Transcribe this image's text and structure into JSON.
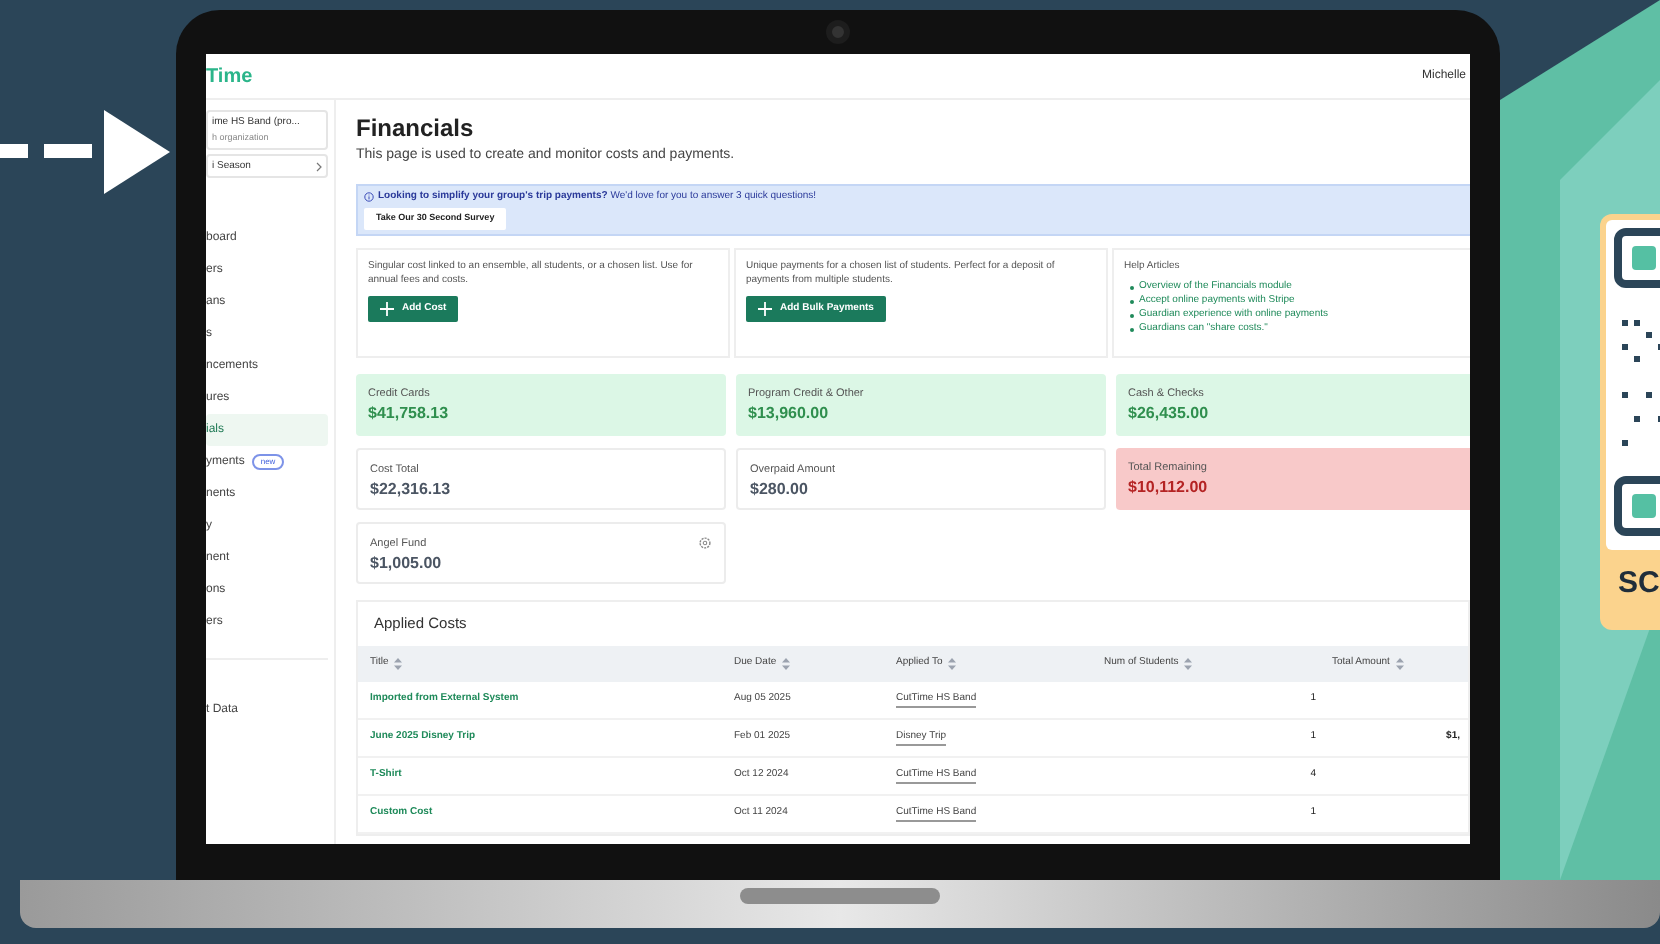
{
  "app": {
    "logo": "Time",
    "user": "Michelle"
  },
  "sidebar": {
    "org_name": "ime HS Band (pro...",
    "org_type": "h organization",
    "season": "i Season",
    "items": [
      {
        "label": "board",
        "selected": false
      },
      {
        "label": "ers",
        "selected": false
      },
      {
        "label": "ans",
        "selected": false
      },
      {
        "label": "s",
        "selected": false
      },
      {
        "label": "ncements",
        "selected": false
      },
      {
        "label": "ures",
        "selected": false
      },
      {
        "label": "ials",
        "selected": true
      },
      {
        "label": "yments",
        "selected": false,
        "badge": "new"
      },
      {
        "label": "nents",
        "selected": false
      },
      {
        "label": "y",
        "selected": false
      },
      {
        "label": "nent",
        "selected": false
      },
      {
        "label": "ons",
        "selected": false
      },
      {
        "label": "ers",
        "selected": false
      }
    ],
    "footer_item": "t Data"
  },
  "page": {
    "title": "Financials",
    "subtitle": "This page is used to create and monitor costs and payments."
  },
  "banner": {
    "bold": "Looking to simplify your group's trip payments?",
    "text": "We'd love for you to answer 3 quick questions!",
    "button": "Take Our 30 Second Survey"
  },
  "actions": [
    {
      "description": "Singular cost linked to an ensemble, all students, or a chosen list. Use for annual fees and costs.",
      "button": "Add Cost"
    },
    {
      "description": "Unique payments for a chosen list of students. Perfect for a deposit of payments from multiple students.",
      "button": "Add Bulk Payments"
    }
  ],
  "help": {
    "title": "Help Articles",
    "links": [
      "Overview of the Financials module",
      "Accept online payments with Stripe",
      "Guardian experience with online payments",
      "Guardians can \"share costs.\""
    ]
  },
  "stats": [
    {
      "label": "Credit Cards",
      "value": "$41,758.13",
      "kind": "positive"
    },
    {
      "label": "Program Credit & Other",
      "value": "$13,960.00",
      "kind": "positive"
    },
    {
      "label": "Cash & Checks",
      "value": "$26,435.00",
      "kind": "positive"
    },
    {
      "label": "Cost Total",
      "value": "$22,316.13",
      "kind": "neutral"
    },
    {
      "label": "Overpaid Amount",
      "value": "$280.00",
      "kind": "neutral"
    },
    {
      "label": "Total Remaining",
      "value": "$10,112.00",
      "kind": "negative"
    },
    {
      "label": "Angel Fund",
      "value": "$1,005.00",
      "kind": "neutral",
      "settings": true
    }
  ],
  "table": {
    "title": "Applied Costs",
    "columns": [
      "Title",
      "Due Date",
      "Applied To",
      "Num of Students",
      "Total Amount"
    ],
    "rows": [
      {
        "title": "Imported from External System",
        "due": "Aug 05 2025",
        "applied_to": "CutTime HS Band",
        "students": "1"
      },
      {
        "title": "June 2025 Disney Trip",
        "due": "Feb 01 2025",
        "applied_to": "Disney Trip",
        "students": "1",
        "total": "$1,"
      },
      {
        "title": "T-Shirt",
        "due": "Oct 12 2024",
        "applied_to": "CutTime HS Band",
        "students": "4"
      },
      {
        "title": "Custom Cost",
        "due": "Oct 11 2024",
        "applied_to": "CutTime HS Band",
        "students": "1"
      }
    ]
  },
  "promo": {
    "text": "SC"
  }
}
